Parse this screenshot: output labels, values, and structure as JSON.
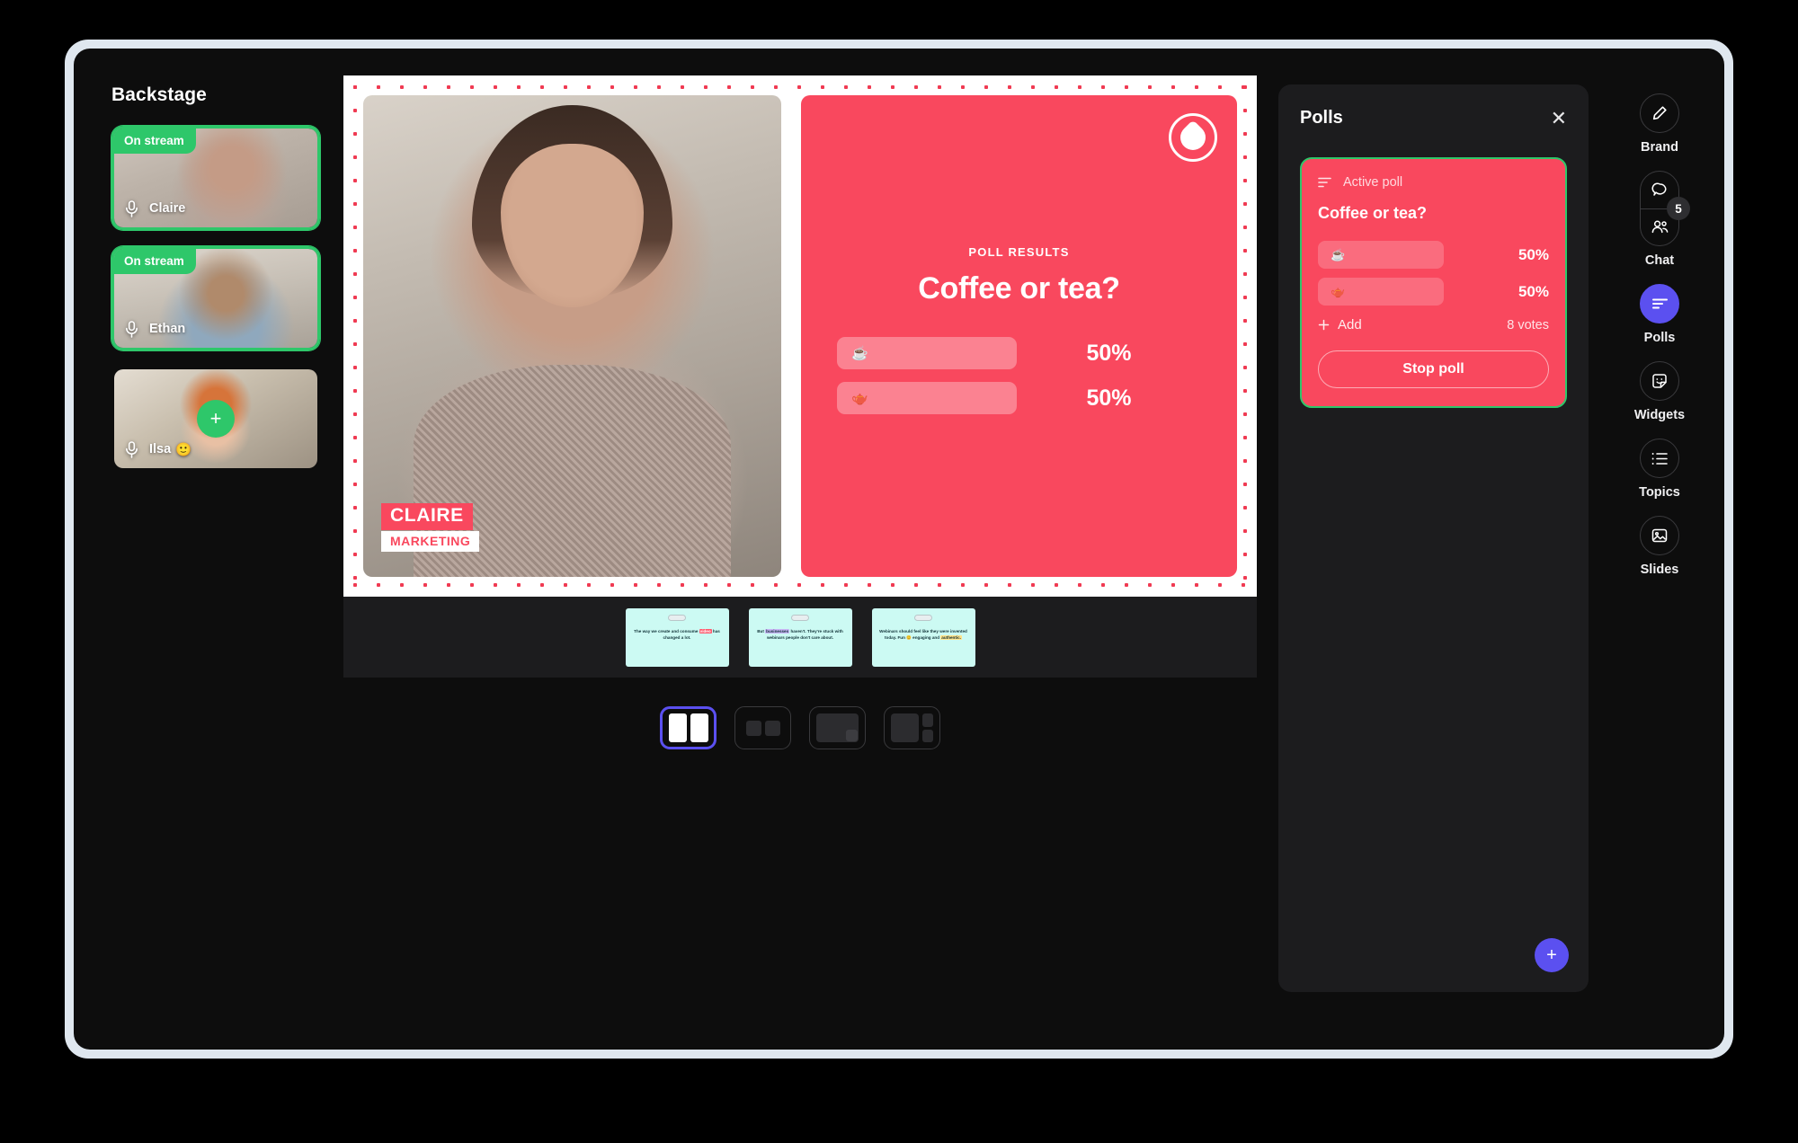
{
  "backstage": {
    "title": "Backstage",
    "participants": [
      {
        "name": "Claire",
        "status": "On stream",
        "on_stream": true,
        "emoji": "",
        "mic_icon": "microphone-icon"
      },
      {
        "name": "Ethan",
        "status": "On stream",
        "on_stream": true,
        "emoji": "",
        "mic_icon": "microphone-icon"
      },
      {
        "name": "Ilsa",
        "status": "",
        "on_stream": false,
        "emoji": "🙂",
        "mic_icon": "microphone-icon",
        "add_label": "+"
      }
    ]
  },
  "stage": {
    "speaker": {
      "lower_third_name": "CLAIRE",
      "lower_third_role": "MARKETING"
    },
    "poll_card": {
      "eyebrow": "POLL RESULTS",
      "question": "Coffee or tea?",
      "logo_icon": "brand-logo-icon",
      "options": [
        {
          "emoji": "☕",
          "percent": "50%"
        },
        {
          "emoji": "🫖",
          "percent": "50%"
        }
      ]
    },
    "slides": [
      {
        "text_html": "The way we create and consume <span class='hl-red'>video</span> has changed a lot."
      },
      {
        "text_html": "But <span class='hl-purple'>businesses</span> haven't. They're stuck with webinars people don't care about."
      },
      {
        "text_html": "Webinars should feel like they were invented today. Fun 😊 engaging and <span class='hl-yellow'>authentic.</span>"
      }
    ],
    "layouts": [
      {
        "name": "split-layout",
        "selected": true
      },
      {
        "name": "duo-layout",
        "selected": false
      },
      {
        "name": "pip-layout",
        "selected": false
      },
      {
        "name": "sidebar-layout",
        "selected": false
      }
    ]
  },
  "polls_panel": {
    "title": "Polls",
    "close_icon": "close-icon",
    "active_poll": {
      "label": "Active poll",
      "label_icon": "poll-lines-icon",
      "question": "Coffee or tea?",
      "options": [
        {
          "emoji": "☕",
          "percent": "50%"
        },
        {
          "emoji": "🫖",
          "percent": "50%"
        }
      ],
      "add_label": "Add",
      "add_icon": "plus-icon",
      "votes": "8 votes",
      "stop_label": "Stop poll"
    },
    "fab_label": "+"
  },
  "rail": {
    "items": [
      {
        "label": "Brand",
        "icon": "pencil-icon",
        "active": false
      },
      {
        "label": "Chat",
        "icon": "chat-people-icon",
        "active": false,
        "badge": "5"
      },
      {
        "label": "Polls",
        "icon": "poll-lines-icon",
        "active": true
      },
      {
        "label": "Widgets",
        "icon": "sticker-icon",
        "active": false
      },
      {
        "label": "Topics",
        "icon": "list-icon",
        "active": false
      },
      {
        "label": "Slides",
        "icon": "image-icon",
        "active": false
      }
    ]
  },
  "colors": {
    "accent_purple": "#5b50f0",
    "poll_pink": "#f9485e",
    "on_stream_green": "#2ec76a",
    "panel_bg": "#1c1c1e",
    "app_bg": "#0d0d0d"
  }
}
